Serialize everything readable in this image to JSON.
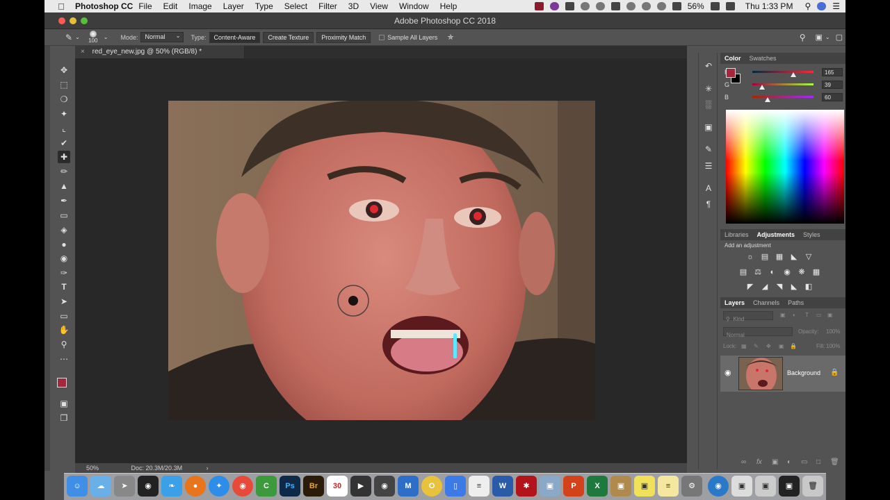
{
  "menubar": {
    "app": "Photoshop CC",
    "items": [
      "File",
      "Edit",
      "Image",
      "Layer",
      "Type",
      "Select",
      "Filter",
      "3D",
      "View",
      "Window",
      "Help"
    ],
    "battery": "56%",
    "clock": "Thu 1:33 PM"
  },
  "window": {
    "title": "Adobe Photoshop CC 2018"
  },
  "options": {
    "brush_size": "100",
    "mode_label": "Mode:",
    "mode_value": "Normal",
    "type_label": "Type:",
    "types": [
      "Content-Aware",
      "Create Texture",
      "Proximity Match"
    ],
    "selected_type": "Content-Aware",
    "sample_all_layers": "Sample All Layers"
  },
  "document": {
    "tab_title": "red_eye_new.jpg @ 50% (RGB/8) *",
    "zoom": "50%",
    "doc_size": "Doc: 20.3M/20.3M"
  },
  "color_panel": {
    "tabs": [
      "Color",
      "Swatches"
    ],
    "active_tab": "Color",
    "r_label": "R",
    "g_label": "G",
    "b_label": "B",
    "r": "165",
    "g": "39",
    "b": "60",
    "foreground_color": "#a5273c"
  },
  "adjustments_panel": {
    "tabs": [
      "Libraries",
      "Adjustments",
      "Styles"
    ],
    "active_tab": "Adjustments",
    "heading": "Add an adjustment"
  },
  "layers_panel": {
    "tabs": [
      "Layers",
      "Channels",
      "Paths"
    ],
    "active_tab": "Layers",
    "kind_placeholder": "Kind",
    "blend_mode": "Normal",
    "opacity_label": "Opacity:",
    "opacity": "100%",
    "lock_label": "Lock:",
    "fill_label": "Fill:",
    "fill": "100%",
    "layers": [
      {
        "name": "Background"
      }
    ]
  }
}
